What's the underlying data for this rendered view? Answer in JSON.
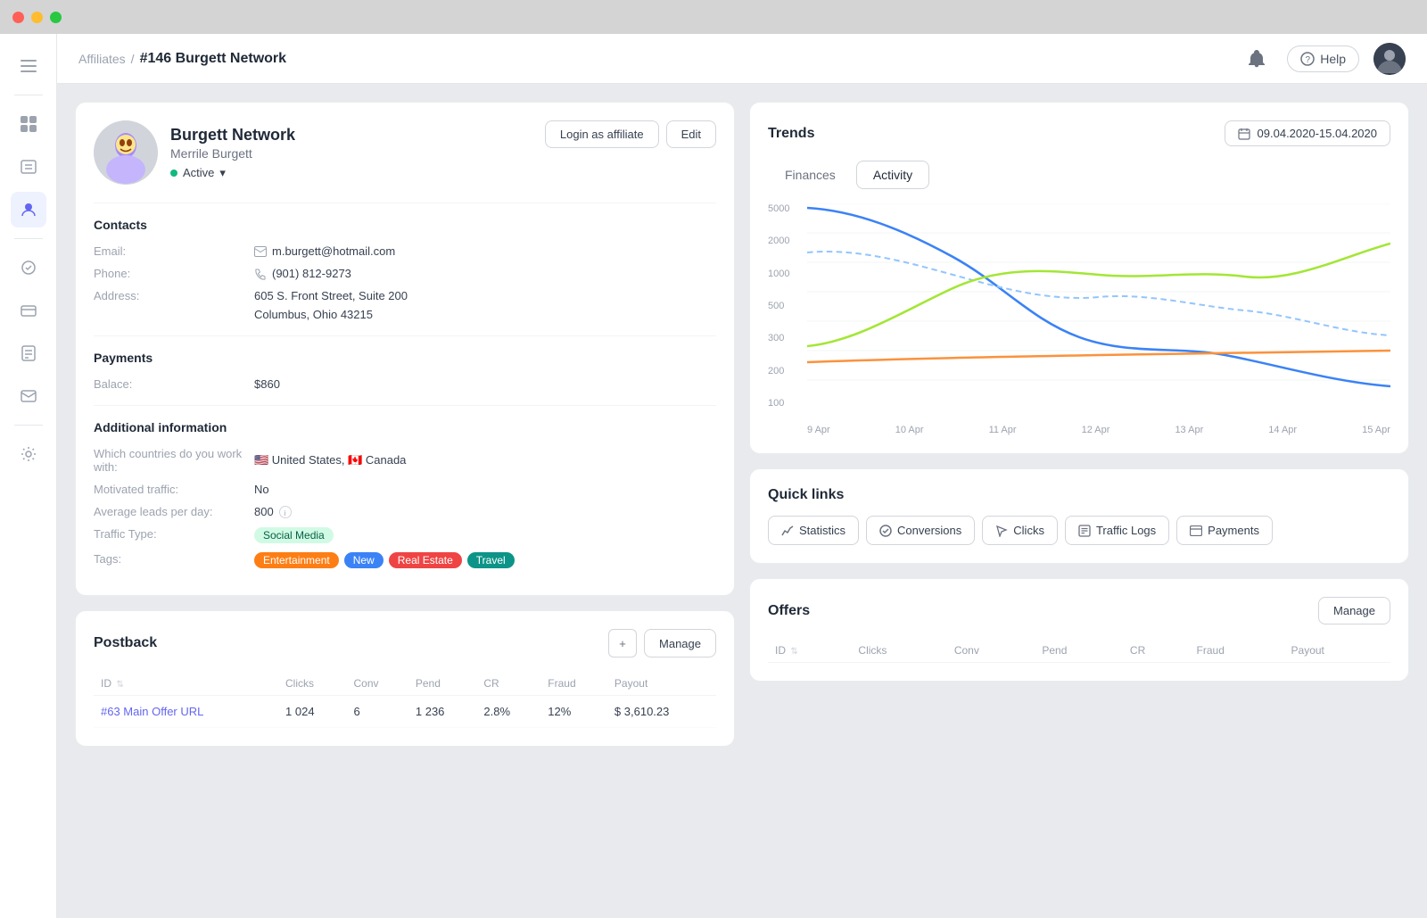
{
  "titlebar": {
    "buttons": [
      "red",
      "yellow",
      "green"
    ]
  },
  "sidebar": {
    "icons": [
      {
        "name": "menu-icon",
        "symbol": "☰",
        "active": false
      },
      {
        "name": "chart-icon",
        "symbol": "📊",
        "active": false
      },
      {
        "name": "contacts-icon",
        "symbol": "📋",
        "active": false
      },
      {
        "name": "affiliates-icon",
        "symbol": "👤",
        "active": true
      },
      {
        "name": "offers-icon",
        "symbol": "🎁",
        "active": false
      },
      {
        "name": "payments-icon",
        "symbol": "💳",
        "active": false
      },
      {
        "name": "reports-icon",
        "symbol": "📄",
        "active": false
      },
      {
        "name": "mail-icon",
        "symbol": "✉",
        "active": false
      },
      {
        "name": "settings-icon",
        "symbol": "⚙",
        "active": false
      }
    ]
  },
  "topbar": {
    "breadcrumb_link": "Affiliates",
    "breadcrumb_separator": "/",
    "breadcrumb_current": "#146 Burgett Network",
    "help_label": "Help",
    "avatar_initials": "👤"
  },
  "profile": {
    "name": "Burgett Network",
    "subtitle": "Merrile Burgett",
    "status": "Active",
    "login_button": "Login as affiliate",
    "edit_button": "Edit",
    "contacts": {
      "title": "Contacts",
      "email_label": "Email:",
      "email_value": "m.burgett@hotmail.com",
      "phone_label": "Phone:",
      "phone_value": "(901) 812-9273",
      "address_label": "Address:",
      "address_line1": "605 S. Front Street, Suite 200",
      "address_line2": "Columbus, Ohio 43215"
    },
    "payments": {
      "title": "Payments",
      "balance_label": "Balace:",
      "balance_value": "$860"
    },
    "additional": {
      "title": "Additional information",
      "countries_label": "Which countries do you work with:",
      "countries_value": "🇺🇸 United States, 🇨🇦 Canada",
      "traffic_label": "Motivated traffic:",
      "traffic_value": "No",
      "leads_label": "Average leads per day:",
      "leads_value": "800",
      "traffic_type_label": "Traffic Type:",
      "traffic_type_value": "Social Media",
      "tags_label": "Tags:",
      "tags": [
        {
          "label": "Entertainment",
          "color": "orange"
        },
        {
          "label": "New",
          "color": "blue"
        },
        {
          "label": "Real Estate",
          "color": "red"
        },
        {
          "label": "Travel",
          "color": "teal"
        }
      ]
    }
  },
  "postback": {
    "title": "Postback",
    "add_label": "+",
    "manage_label": "Manage",
    "columns": [
      "ID",
      "Clicks",
      "Conv",
      "Pend",
      "CR",
      "Fraud",
      "Payout"
    ],
    "rows": [
      {
        "id": "#63",
        "name": "Main Offer URL",
        "clicks": "1 024",
        "conv": "6",
        "pend": "1 236",
        "cr": "2.8%",
        "fraud": "12%",
        "payout": "$ 3,610.23"
      }
    ]
  },
  "trends": {
    "title": "Trends",
    "date_range": "09.04.2020-15.04.2020",
    "tabs": [
      "Finances",
      "Activity"
    ],
    "active_tab": "Activity",
    "chart": {
      "y_labels": [
        "5000",
        "2000",
        "1000",
        "500",
        "300",
        "200",
        "100"
      ],
      "x_labels": [
        "9 Apr",
        "10 Apr",
        "11 Apr",
        "12 Apr",
        "13 Apr",
        "14 Apr",
        "15 Apr"
      ]
    }
  },
  "quick_links": {
    "title": "Quick links",
    "links": [
      {
        "label": "Statistics",
        "icon": "chart"
      },
      {
        "label": "Conversions",
        "icon": "check"
      },
      {
        "label": "Clicks",
        "icon": "cursor"
      },
      {
        "label": "Traffic Logs",
        "icon": "list"
      },
      {
        "label": "Payments",
        "icon": "card"
      }
    ]
  },
  "offers": {
    "title": "Offers",
    "manage_label": "Manage",
    "columns": [
      "ID",
      "Clicks",
      "Conv",
      "Pend",
      "CR",
      "Fraud",
      "Payout"
    ]
  }
}
